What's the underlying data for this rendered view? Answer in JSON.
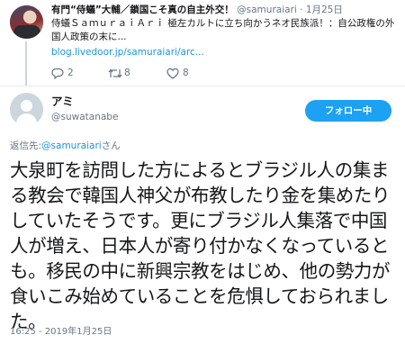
{
  "quoted_tweet": {
    "display_name": "有門“侍蟻”大輔／鎖国こそ真の自主外交！",
    "handle": "@samuraiari",
    "separator": "·",
    "date": "1月25日",
    "text": "侍蟻ＳａｍｕｒａｉＡｒｉ 極左カルトに立ち向かうネオ民族派！：自公政権の外国人政策の末に...",
    "link": "blog.livedoor.jp/samuraiari/arc...",
    "reply_count": "2",
    "retweet_count": "8",
    "like_count": "8"
  },
  "main_tweet": {
    "display_name": "アミ",
    "handle": "@suwatanabe",
    "follow_label": "フォロー中",
    "reply_prefix": "返信先:",
    "reply_handle": "@samuraiari",
    "reply_suffix": "さん",
    "text": "大泉町を訪問した方によるとブラジル人の集まる教会で韓国人神父が布教したり金を集めたりしていたそうです。更にブラジル人集落で中国人が増え、日本人が寄り付かなくなっているとも。移民の中に新興宗教をはじめ、他の勢力が食いこみ始めていることを危惧しておられました。",
    "timestamp": "16:25 - 2019年1月25日"
  },
  "colors": {
    "accent": "#1da1f2",
    "link": "#1b95e0",
    "secondary_text": "#657786",
    "primary_text": "#14171a",
    "separator": "#e6ecf0"
  },
  "icons": {
    "reply": "reply-icon",
    "retweet": "retweet-icon",
    "like": "heart-icon"
  }
}
